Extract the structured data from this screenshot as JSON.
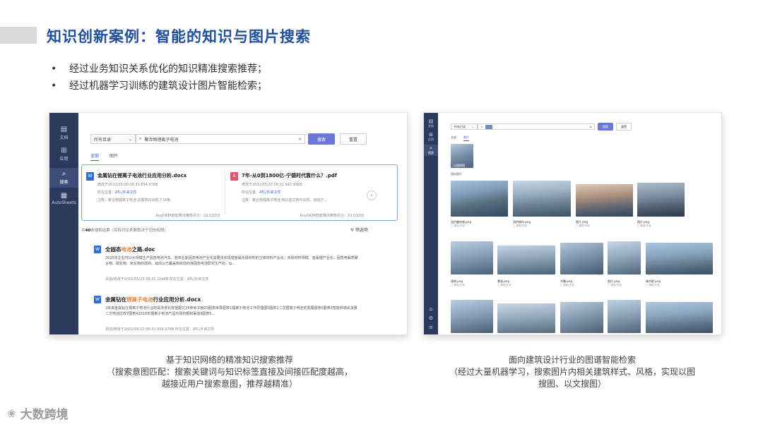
{
  "slide": {
    "title": "知识创新案例：智能的知识与图片搜索",
    "bullets": [
      "经过业务知识关系优化的知识精准搜索推荐；",
      "经过机器学习训练的建筑设计图片智能检索；"
    ],
    "bullet_symbol": "•"
  },
  "left_panel": {
    "nav": [
      {
        "label": "文档",
        "icon": "document-icon"
      },
      {
        "label": "应用",
        "icon": "apps-grid-icon"
      },
      {
        "label": "搜索",
        "icon": "search-icon",
        "active": true
      },
      {
        "label": "AutoSheets",
        "icon": "sheets-icon"
      }
    ],
    "scope_select": "所有目录",
    "search_value": "聚合物锂离子电池",
    "search_button": "搜索",
    "reset_button": "重置",
    "tabs": [
      "全部",
      "图片"
    ],
    "featured": [
      {
        "title": "金属钻在锂离子电池行业应用分析.docx",
        "type": "W",
        "meta1": "修改于2021/05/20 08:31    894.97KB",
        "location_label": "所在位置：",
        "location_value": "ATL/外来文件",
        "note": "注释：聚合物锂离子电池 关联知识出现了16条。",
        "score": "AnyDATA智能算法推荐评分：10.0/10分"
      },
      {
        "title": "7年-从0到1800亿-宁德时代靠什么？.pdf",
        "type": "A",
        "meta1": "修改于2021/05/20 08:31    942.99KB",
        "location_label": "所在位置：",
        "location_value": "ATL/外来文件",
        "note": "注释：聚合物锂离子电池 知识在文档中出现，目前已…",
        "score": "AnyDATA智能算法推荐评分：10.0/10分"
      }
    ],
    "next_arrow": "›",
    "result_count_prefix": "共",
    "result_count": "40",
    "result_count_suffix": "条搜索结果（实际可见条数取决于您的权限）",
    "filter_label": "筛选项",
    "results": [
      {
        "title_parts": [
          "全固态",
          "电池",
          "之路.doc"
        ],
        "desc": "2025年左右可以大规模生产固态电池汽车。若商业能固态电池产业化需要先实现锂金属负极材料的卫级材料产业化；负极材料规模、金属锂产业化；固态电解质聚合物、硫化物、氧化物的成熟。目前以已覆盖到目前的连固态电池研究生产的，ip…",
        "meta": "添加/修改于2021/05/20 08:31    229KB        所在位置：ATL/外来文件"
      },
      {
        "title_parts": [
          "金属钻在",
          "锂离子电池",
          "行业应用分析.docx"
        ],
        "desc": "2未来金属钻在锂离子电池行业的需求增长有望超过26参考文献29图表目录图表1锂离子电池工作原理图5图表2二次锂离子电池史发展顺序6图表3智能终端出货量二次电池比较7图表42010年锂离子电池产品市场份额和渠道9图表5…",
        "meta": "添加/修改于2021/05/20 08:31    894.97KB        所在位置：ATL/外来文件"
      }
    ]
  },
  "right_panel": {
    "nav": [
      {
        "label": "文档",
        "icon": "document-icon"
      },
      {
        "label": "应用",
        "icon": "apps-grid-icon"
      },
      {
        "label": "搜索",
        "icon": "search-icon",
        "active": true
      }
    ],
    "scope_select": "所有目录",
    "search_button": "搜索",
    "reset_button": "重置",
    "tabs": [
      "全部",
      "图片"
    ],
    "query_image_label": "以图搜图",
    "section_label": "相似图片",
    "row1": [
      {
        "name": "纽约曼哈顿.png",
        "sub": "□ 建筑/外观"
      },
      {
        "name": "纽约城市.png",
        "sub": "□ 建筑/外观"
      },
      {
        "name": "图片.png",
        "sub": "□ 建筑/外观"
      },
      {
        "name": "图片.png",
        "sub": "□ 建筑/外观"
      }
    ],
    "row2": [
      {
        "name": "建筑.png",
        "sub": "□ 建筑/外观"
      },
      {
        "name": "景观.png",
        "sub": "□ 建筑/外观"
      },
      {
        "name": "鸟瞰.png",
        "sub": "□ 建筑/外观"
      },
      {
        "name": "图片.png",
        "sub": "□ 建筑/外观"
      },
      {
        "name": "城市群.png",
        "sub": "□ 建筑/外观"
      }
    ]
  },
  "captions": {
    "left": [
      "基于知识网络的精准知识搜索推荐",
      "（搜索意图匹配：搜索关键词与知识标签直接及间接匹配度越高，",
      "越接近用户搜索意图，推荐越精准）"
    ],
    "right": [
      "面向建筑设计行业的图谱智能检索",
      "（经过大量机器学习，搜索图片内相关建筑样式、风格，实现以图",
      "搜图、以文搜图）"
    ]
  },
  "watermark": "大数跨境",
  "colors": {
    "title": "#1f4e9e",
    "sidebar": "#2b3a5c",
    "primary_button": "#6c78d8",
    "highlight": "#e8833a",
    "feature_border": "#6fa8dc"
  }
}
